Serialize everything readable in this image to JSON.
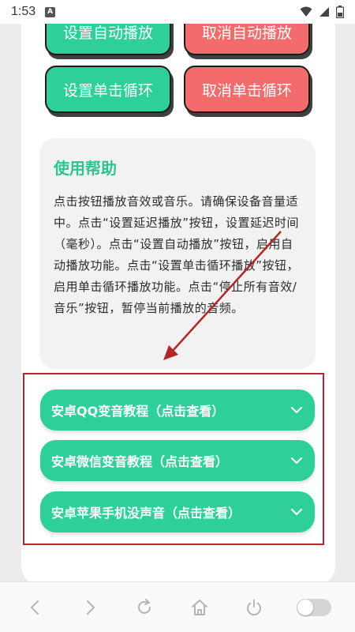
{
  "status": {
    "time": "1:53",
    "notification_badge": "A"
  },
  "buttons": {
    "set_autoplay": "设置自动播放",
    "cancel_autoplay": "取消自动播放",
    "set_single_loop": "设置单击循环",
    "cancel_single_loop": "取消单击循环"
  },
  "help": {
    "title": "使用帮助",
    "text": "点击按钮播放音效或音乐。请确保设备音量适中。点击“设置延迟播放”按钮，设置延迟时间（毫秒）。点击“设置自动播放”按钮，启用自动播放功能。点击“设置单击循环播放”按钮，启用单击循环播放功能。点击“停止所有音效/音乐”按钮，暂停当前播放的音频。"
  },
  "tutorials": [
    {
      "label": "安卓QQ变音教程（点击查看）"
    },
    {
      "label": "安卓微信变音教程（点击查看）"
    },
    {
      "label": "安卓苹果手机没声音（点击查看）"
    }
  ],
  "colors": {
    "accent_green": "#2dd098",
    "accent_red": "#f36b6b",
    "annotation_red": "#b4262a"
  },
  "icons": {
    "nav": [
      "back-icon",
      "forward-icon",
      "refresh-icon",
      "home-icon",
      "power-icon",
      "toggle-switch"
    ]
  }
}
